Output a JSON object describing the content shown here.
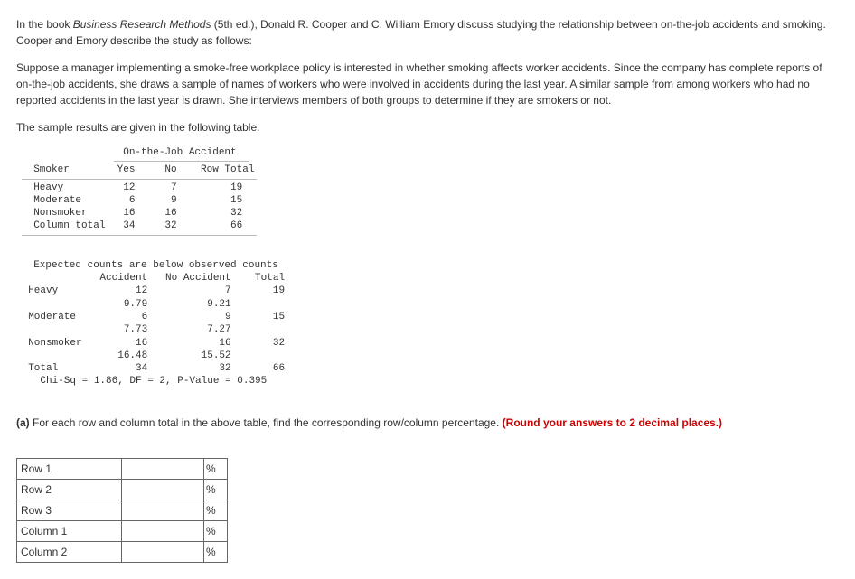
{
  "intro": {
    "p1a": "In the book ",
    "p1b": "Business Research Methods",
    "p1c": " (5th ed.), Donald R. Cooper and C. William Emory discuss studying the relationship between on-the-job accidents and smoking. Cooper and Emory describe the study as follows:",
    "p2": "Suppose a manager implementing a smoke-free workplace policy is interested in whether smoking affects worker accidents. Since the company has complete reports of on-the-job accidents, she draws a sample of names of workers who were involved in accidents during the last year. A similar sample from among workers who had no reported accidents in the last year is drawn. She interviews members of both groups to determine if they are smokers or not.",
    "p3": "The sample results are given in the following table."
  },
  "table1": {
    "header": "                 On-the-Job Accident",
    "cols": "  Smoker        Yes     No    Row Total",
    "r1": "  Heavy          12      7         19",
    "r2": "  Moderate        6      9         15",
    "r3": "  Nonsmoker      16     16         32",
    "r4": "  Column total   34     32         66"
  },
  "table2": {
    "l1": "  Expected counts are below observed counts",
    "l2": "              Accident   No Accident    Total",
    "l3": "  Heavy             12             7       19",
    "l4": "                  9.79          9.21",
    "l5": "  Moderate           6             9       15",
    "l6": "                  7.73          7.27",
    "l7": "  Nonsmoker         16            16       32",
    "l8": "                 16.48         15.52",
    "l9": "  Total             34            32       66",
    "l10": "    Chi-Sq = 1.86, DF = 2, P-Value = 0.395"
  },
  "question": {
    "label": "(a)",
    "text": " For each row and column total in the above table, find the corresponding row/column percentage. ",
    "hint": "(Round your answers to 2 decimal places.)"
  },
  "answers": {
    "rows": [
      {
        "label": "Row 1",
        "unit": "%"
      },
      {
        "label": "Row 2",
        "unit": "%"
      },
      {
        "label": "Row 3",
        "unit": "%"
      },
      {
        "label": "Column 1",
        "unit": "%"
      },
      {
        "label": "Column 2",
        "unit": "%"
      }
    ]
  }
}
